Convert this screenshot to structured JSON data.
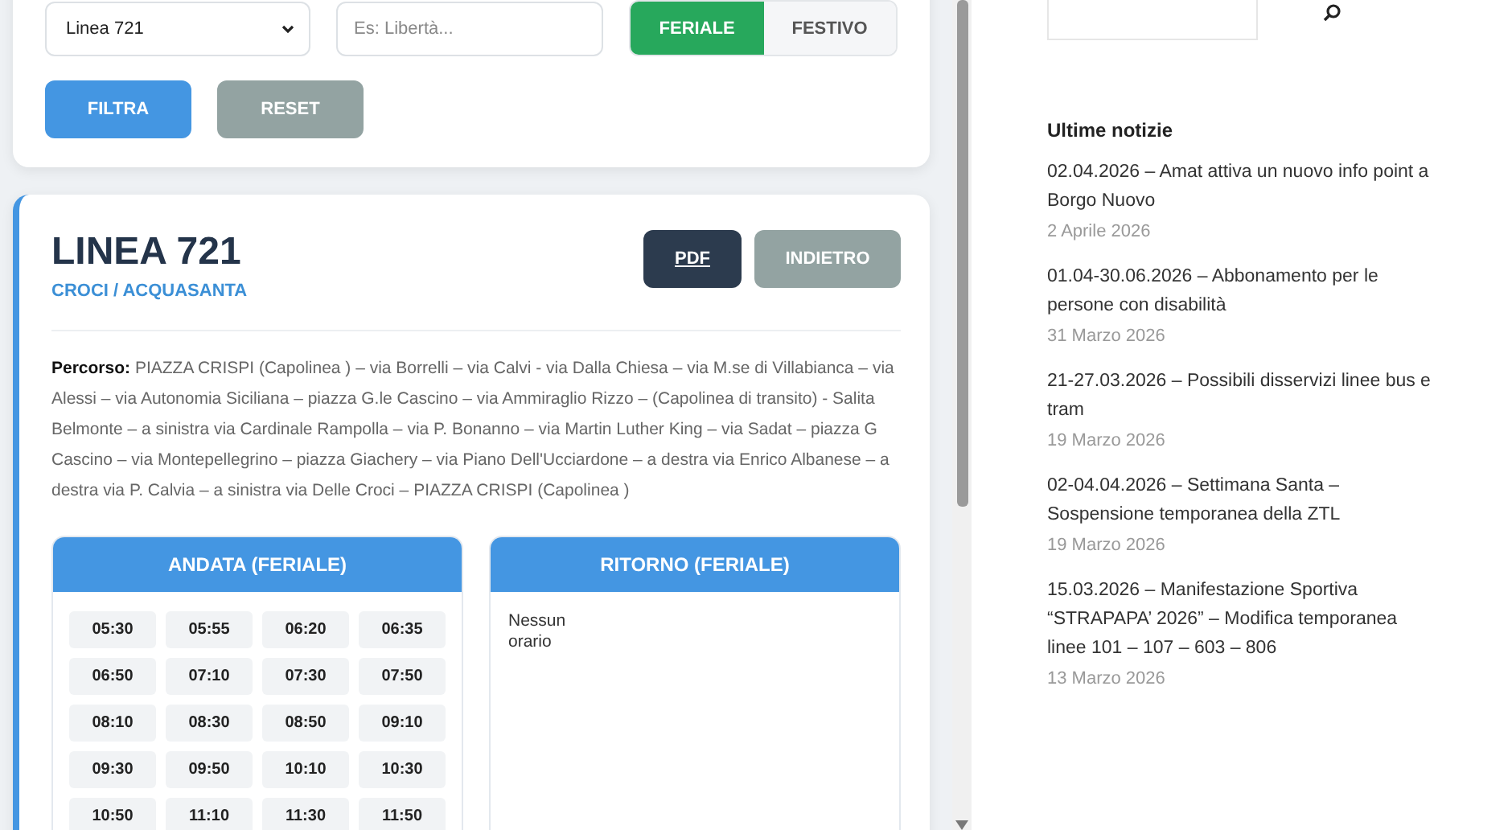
{
  "filter": {
    "line_select": "Linea 721",
    "search": {
      "placeholder": "Es: Libertà..."
    },
    "day_types": [
      {
        "label": "FERIALE",
        "selected": true
      },
      {
        "label": "FESTIVO",
        "selected": false
      }
    ],
    "buttons": [
      {
        "label": "FILTRA",
        "kind": "primary"
      },
      {
        "label": "RESET",
        "kind": "secondary"
      }
    ]
  },
  "line": {
    "title": "LINEA 721",
    "subtitle": "CROCI / ACQUASANTA",
    "buttons": [
      {
        "label": "PDF",
        "kind": "dark"
      },
      {
        "label": "INDIETRO",
        "kind": "secondary"
      }
    ],
    "route": "**Percorso:** PIAZZA CRISPI (Capolinea ) – via Borrelli – via Calvi - via Dalla Chiesa – via M.se di Villabianca – via Alessi – via Autonomia Siciliana – piazza G.le Cascino – via Ammiraglio Rizzo – (Capolinea di transito) - Salita Belmonte – a sinistra via Cardinale Rampolla – via P. Bonanno – via Martin Luther King – via Sadat – piazza G Cascino – via Montepellegrino – piazza Giachery – via Piano Dell'Ucciardone – a destra via Enrico Albanese – a destra via P. Calvia – a sinistra via Delle Croci – PIAZZA CRISPI (Capolinea )",
    "directions": [
      {
        "title": "ANDATA (FERIALE)",
        "times": [
          "05:30",
          "05:55",
          "06:20",
          "06:35",
          "06:50",
          "07:10",
          "07:30",
          "07:50",
          "08:10",
          "08:30",
          "08:50",
          "09:10",
          "09:30",
          "09:50",
          "10:10",
          "10:30",
          "10:50",
          "11:10",
          "11:30",
          "11:50"
        ]
      },
      {
        "title": "RITORNO (FERIALE)",
        "empty_text": "Nessun orario"
      }
    ]
  },
  "sidebar": {
    "heading": "Ultime notizie",
    "news": [
      {
        "title": "02.04.2026 – Amat attiva un nuovo info point a Borgo Nuovo",
        "date": "2 Aprile 2026"
      },
      {
        "title": "01.04-30.06.2026 – Abbonamento per le persone con disabilità",
        "date": "31 Marzo 2026"
      },
      {
        "title": "21-27.03.2026 – Possibili disservizi linee bus e tram",
        "date": "19 Marzo 2026"
      },
      {
        "title": "02-04.04.2026 – Settimana Santa – Sospensione temporanea della ZTL",
        "date": "19 Marzo 2026"
      },
      {
        "title": "15.03.2026 – Manifestazione Sportiva “STRAPAPA’ 2026” – Modifica temporanea linee 101 – 107 – 603 – 806",
        "date": "13 Marzo 2026"
      }
    ]
  }
}
